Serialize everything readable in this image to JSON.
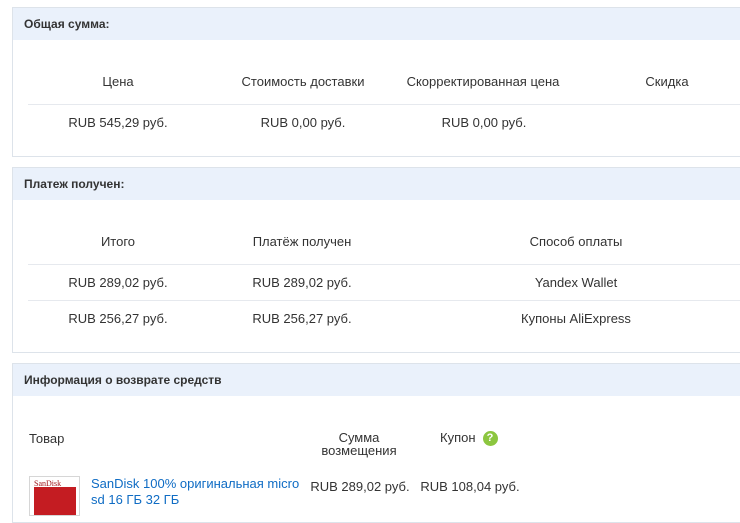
{
  "total_panel": {
    "title": "Общая сумма:",
    "columns": [
      "Цена",
      "Стоимость доставки",
      "Скорректированная цена",
      "Скидка"
    ],
    "row": [
      "RUB 545,29 руб.",
      "RUB 0,00 руб.",
      "RUB 0,00 руб.",
      ""
    ]
  },
  "payment_panel": {
    "title": "Платеж получен:",
    "columns": [
      "Итого",
      "Платёж получен",
      "Способ оплаты"
    ],
    "rows": [
      [
        "RUB 289,02 руб.",
        "RUB 289,02 руб.",
        "Yandex Wallet"
      ],
      [
        "RUB 256,27 руб.",
        "RUB 256,27 руб.",
        "Купоны AliExpress"
      ]
    ]
  },
  "refund_panel": {
    "title": "Информация о возврате средств",
    "col_product": "Товар",
    "col_refund_line1": "Сумма",
    "col_refund_line2": "возмещения",
    "col_coupon": "Купон",
    "coupon_help_icon": "question-circle-icon",
    "coupon_icon_glyph": "?",
    "item": {
      "title_line1": "SanDisk 100% оригинальная micro",
      "title_line2": "sd 16 ГБ 32 ГБ",
      "thumb_text": "SanDisk",
      "refund": "RUB 289,02 руб.",
      "coupon": "RUB 108,04 руб."
    }
  },
  "colors": {
    "header_bg": "#eaf1fb",
    "link": "#0f6cc4",
    "coupon_icon": "#8cc63f"
  }
}
